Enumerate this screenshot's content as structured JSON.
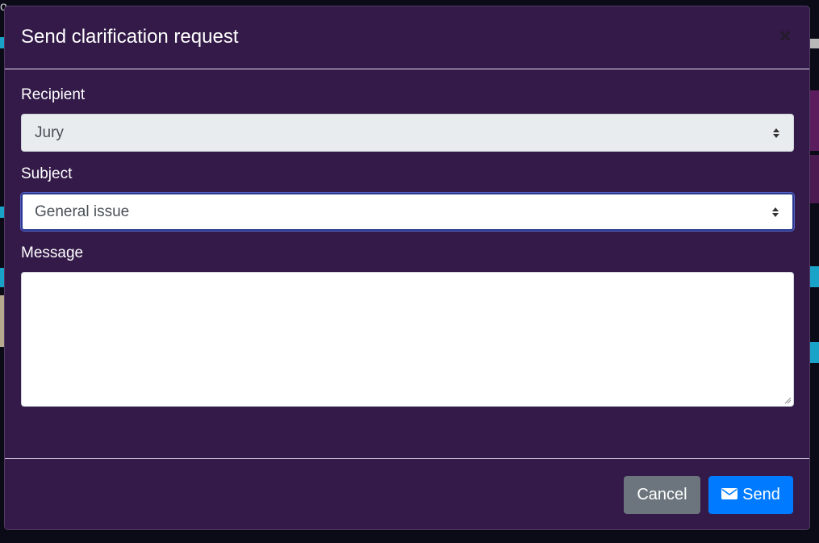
{
  "modal": {
    "title": "Send clarification request",
    "close_label": "×"
  },
  "form": {
    "recipient": {
      "label": "Recipient",
      "selected": "Jury",
      "disabled": true
    },
    "subject": {
      "label": "Subject",
      "selected": "General issue",
      "focused": true
    },
    "message": {
      "label": "Message",
      "value": ""
    }
  },
  "footer": {
    "cancel_label": "Cancel",
    "send_label": "Send",
    "send_icon": "envelope-icon"
  },
  "colors": {
    "modal_bg": "#331a48",
    "send_button": "#007bff",
    "cancel_button": "#6c757d"
  }
}
